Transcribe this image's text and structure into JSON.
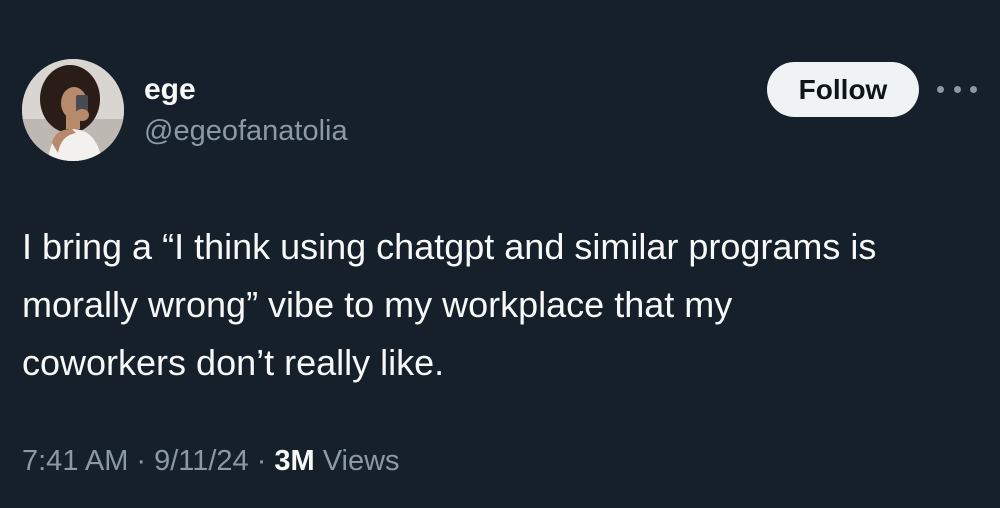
{
  "author": {
    "display_name": "ege",
    "handle": "@egeofanatolia"
  },
  "actions": {
    "follow_label": "Follow"
  },
  "tweet": {
    "text": "I bring a “I think using chatgpt and similar programs is\nmorally wrong” vibe to my workplace that my\ncoworkers don’t really like.",
    "time": "7:41 AM",
    "date": "9/11/24",
    "separator": "·",
    "views_count": "3M",
    "views_label": "Views"
  },
  "icons": {
    "more": "more-horizontal-icon"
  },
  "colors": {
    "background": "#15202b",
    "primary_text": "#f7f9f9",
    "secondary_text": "#8b98a5",
    "follow_button_bg": "#eff3f4",
    "follow_button_text": "#0f1419"
  }
}
